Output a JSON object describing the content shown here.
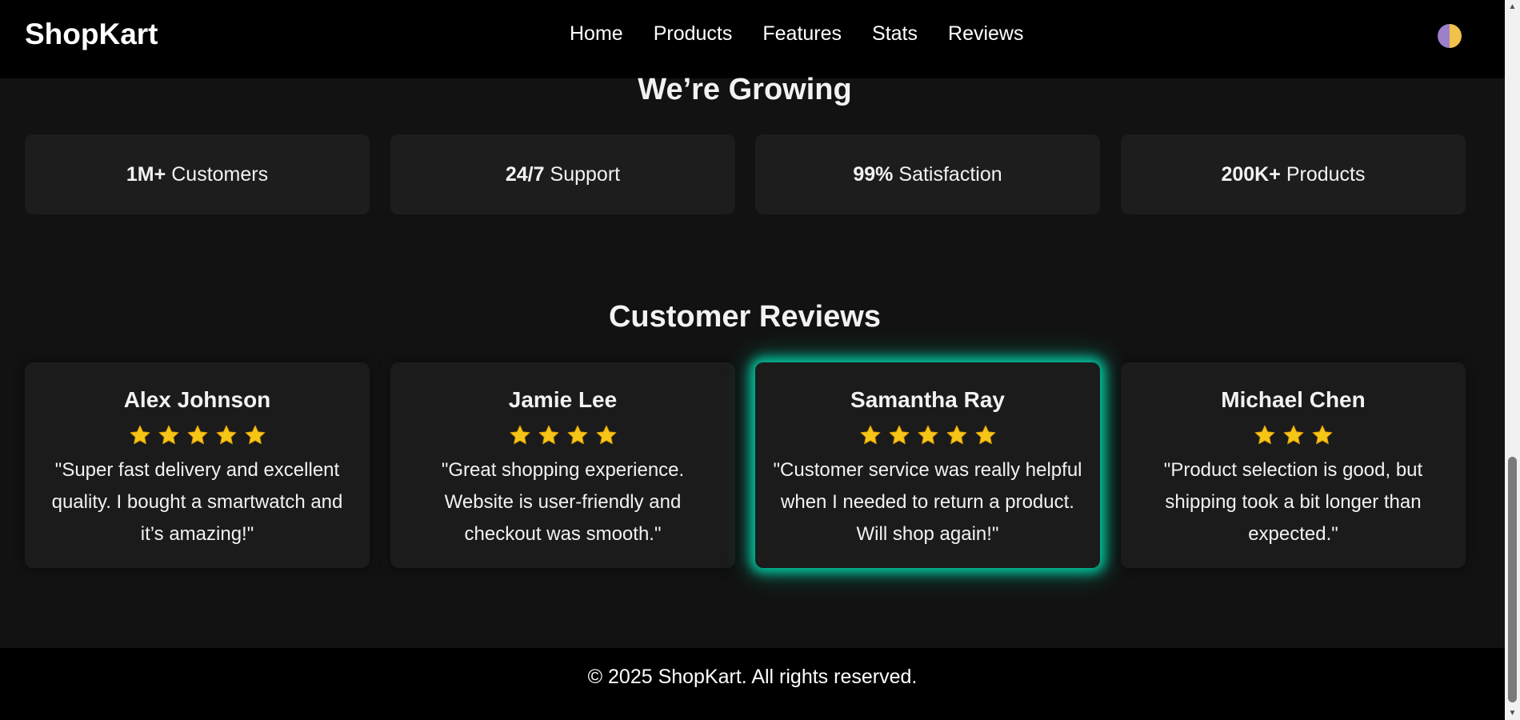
{
  "header": {
    "logo": "ShopKart",
    "nav": [
      "Home",
      "Products",
      "Features",
      "Stats",
      "Reviews"
    ],
    "theme_toggle_icon": "half-moon-icon"
  },
  "stats": {
    "title": "We’re Growing",
    "items": [
      {
        "value": "1M+",
        "label": "Customers"
      },
      {
        "value": "24/7",
        "label": "Support"
      },
      {
        "value": "99%",
        "label": "Satisfaction"
      },
      {
        "value": "200K+",
        "label": "Products"
      }
    ]
  },
  "reviews": {
    "title": "Customer Reviews",
    "items": [
      {
        "name": "Alex Johnson",
        "rating": 5,
        "text": "\"Super fast delivery and excellent quality. I bought a smartwatch and it’s amazing!\""
      },
      {
        "name": "Jamie Lee",
        "rating": 4,
        "text": "\"Great shopping experience. Website is user-friendly and checkout was smooth.\""
      },
      {
        "name": "Samantha Ray",
        "rating": 5,
        "text": "\"Customer service was really helpful when I needed to return a product. Will shop again!\""
      },
      {
        "name": "Michael Chen",
        "rating": 3,
        "text": "\"Product selection is good, but shipping took a bit longer than expected.\""
      }
    ],
    "star_icon": "star-icon",
    "star_color": "#f5c518",
    "highlight_color": "#00dcaf"
  },
  "footer": {
    "text": "© 2025 ShopKart. All rights reserved."
  }
}
